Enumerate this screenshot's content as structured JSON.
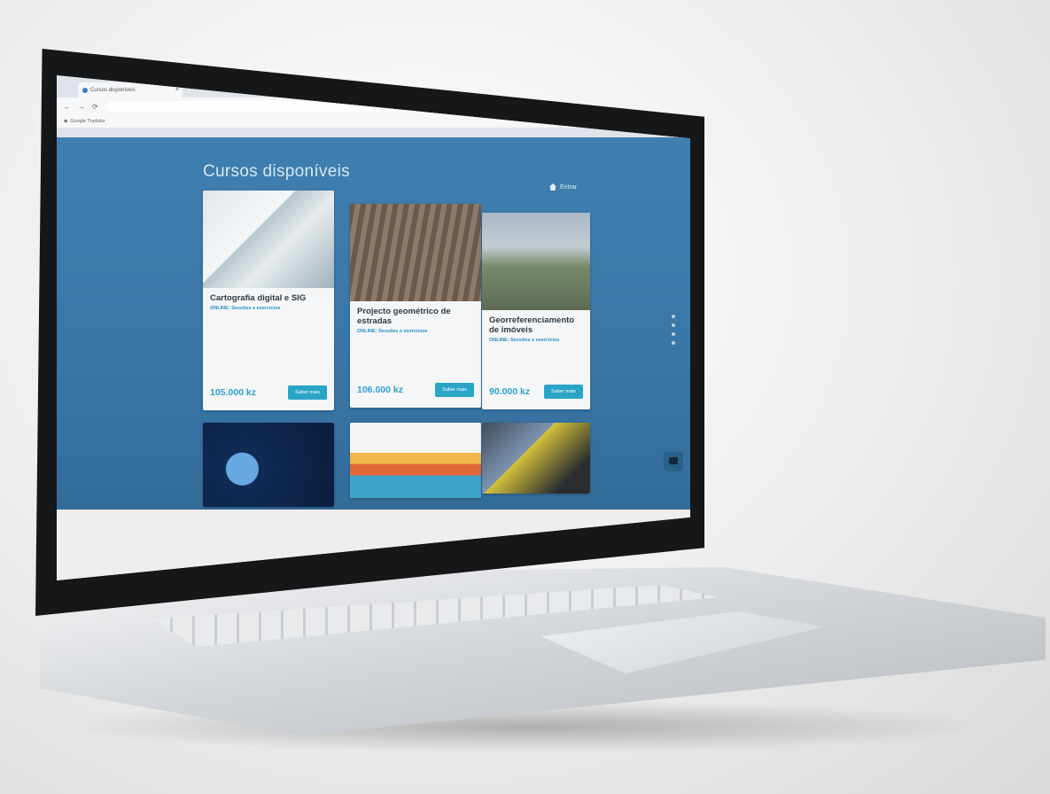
{
  "browser": {
    "tab_title": "Cursos disponíveis",
    "tab_close": "×",
    "new_tab": "+",
    "nav_back": "←",
    "nav_forward": "→",
    "nav_reload": "⟳",
    "url": "",
    "bookmarks_label": "Google Tradutor"
  },
  "page": {
    "title": "Cursos disponíveis",
    "account_label": "Entrar"
  },
  "courses": [
    {
      "title": "Cartografia digital e SIG",
      "tag": "ONLINE: Sessões e exercícios",
      "desc": "",
      "price": "105.000 kz",
      "button": "Saber mais",
      "image": "tablet-map-image"
    },
    {
      "title": "Projecto geométrico de estradas",
      "tag": "ONLINE: Sessões e exercícios",
      "desc": "",
      "price": "106.000 kz",
      "button": "Saber mais",
      "image": "railway-image"
    },
    {
      "title": "Georreferenciamento de imóveis",
      "tag": "ONLINE: Sessões e exercícios",
      "desc": "",
      "price": "90.000 kz",
      "button": "Saber mais",
      "image": "aerial-image"
    },
    {
      "image": "tech-globe-image"
    },
    {
      "image": "city-illustration-image"
    },
    {
      "image": "field-worker-image"
    }
  ],
  "colors": {
    "page_bg": "#3a76a6",
    "accent": "#2aa5c8",
    "price": "#2f9fd0"
  }
}
